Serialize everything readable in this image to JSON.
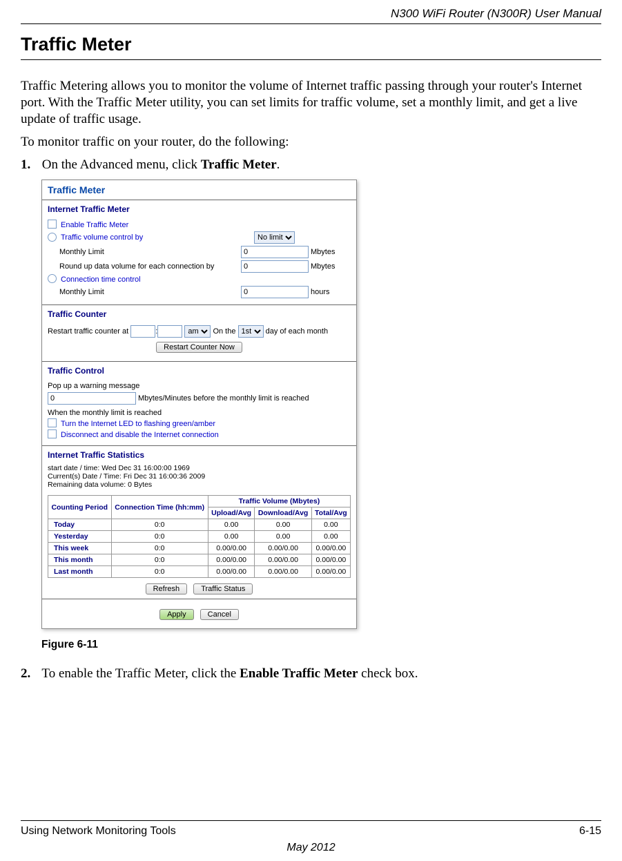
{
  "header": {
    "doc_title": "N300 WiFi Router (N300R) User Manual"
  },
  "h1": "Traffic Meter",
  "intro": "Traffic Metering allows you to monitor the volume of Internet traffic passing through your router's Internet port. With the Traffic Meter utility, you can set limits for traffic volume, set a monthly limit, and get a live update of traffic usage.",
  "para2": "To monitor traffic on your router, do the following:",
  "step1": {
    "num": "1.",
    "pre": "On the Advanced menu, click ",
    "bold": "Traffic Meter",
    "post": "."
  },
  "figure_caption": "Figure 6-11",
  "step2": {
    "num": "2.",
    "pre": "To enable the Traffic Meter, click the ",
    "bold": "Enable Traffic Meter",
    "post": " check box."
  },
  "footer": {
    "left": "Using Network Monitoring Tools",
    "right": "6-15",
    "date": "May 2012"
  },
  "shot": {
    "title": "Traffic Meter",
    "itm": {
      "heading": "Internet Traffic Meter",
      "enable": "Enable Traffic Meter",
      "vol_ctrl": "Traffic volume control by",
      "vol_sel": "No limit",
      "monthly_limit": "Monthly Limit",
      "monthly_val": "0",
      "monthly_unit": "Mbytes",
      "round": "Round up data volume for each connection by",
      "round_val": "0",
      "round_unit": "Mbytes",
      "time_ctrl": "Connection time control",
      "time_limit": "Monthly Limit",
      "time_val": "0",
      "time_unit": "hours"
    },
    "counter": {
      "heading": "Traffic Counter",
      "restart_pre": "Restart traffic counter at",
      "hh": "",
      "mm": "",
      "ampm": "am",
      "on_the": "On the",
      "day_sel": "1st",
      "day_post": "day of each month",
      "btn_restart": "Restart Counter Now"
    },
    "control": {
      "heading": "Traffic Control",
      "popup": "Pop up a warning message",
      "warn_val": "0",
      "warn_post": "Mbytes/Minutes before the monthly limit is reached",
      "when": "When the monthly limit is reached",
      "led": "Turn the Internet LED to flashing green/amber",
      "disc": "Disconnect and disable the Internet connection"
    },
    "stats": {
      "heading": "Internet Traffic Statistics",
      "start": "start date / time: Wed Dec 31 16:00:00 1969",
      "current": "Current(s) Date / Time: Fri Dec 31 16:00:36 2009",
      "remaining": "Remaining data volume: 0 Bytes",
      "cols": {
        "period": "Counting Period",
        "conn": "Connection Time (hh:mm)",
        "vol_head": "Traffic Volume (Mbytes)",
        "up": "Upload/Avg",
        "down": "Download/Avg",
        "total": "Total/Avg"
      },
      "rows": [
        {
          "period": "Today",
          "conn": "0:0",
          "up": "0.00",
          "down": "0.00",
          "total": "0.00"
        },
        {
          "period": "Yesterday",
          "conn": "0:0",
          "up": "0.00",
          "down": "0.00",
          "total": "0.00"
        },
        {
          "period": "This week",
          "conn": "0:0",
          "up": "0.00/0.00",
          "down": "0.00/0.00",
          "total": "0.00/0.00"
        },
        {
          "period": "This month",
          "conn": "0:0",
          "up": "0.00/0.00",
          "down": "0.00/0.00",
          "total": "0.00/0.00"
        },
        {
          "period": "Last month",
          "conn": "0:0",
          "up": "0.00/0.00",
          "down": "0.00/0.00",
          "total": "0.00/0.00"
        }
      ],
      "btn_refresh": "Refresh",
      "btn_status": "Traffic Status",
      "btn_apply": "Apply",
      "btn_cancel": "Cancel"
    }
  }
}
